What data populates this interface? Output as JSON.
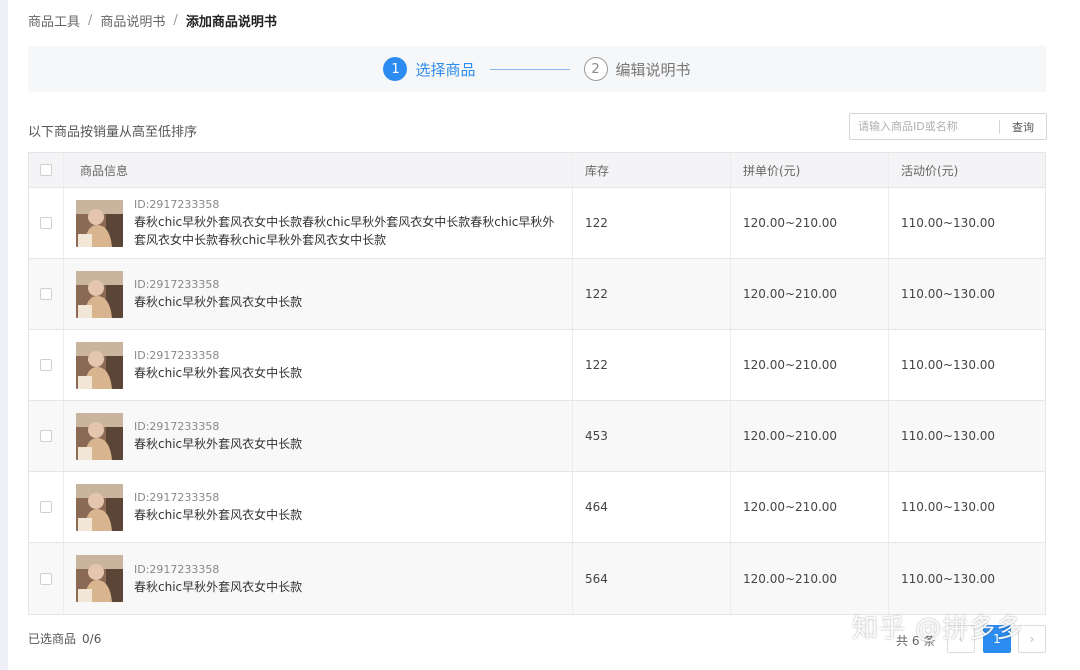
{
  "breadcrumb": {
    "items": [
      "商品工具",
      "商品说明书"
    ],
    "separator": "/",
    "current": "添加商品说明书"
  },
  "steps": [
    {
      "number": "1",
      "label": "选择商品",
      "state": "active"
    },
    {
      "number": "2",
      "label": "编辑说明书",
      "state": "inactive"
    }
  ],
  "toolbar": {
    "sort_note": "以下商品按销量从高至低排序",
    "search_placeholder": "请输入商品ID或名称",
    "search_button": "查询"
  },
  "table": {
    "headers": {
      "info": "商品信息",
      "stock": "库存",
      "group_price": "拼单价(元)",
      "activity_price": "活动价(元)"
    },
    "rows": [
      {
        "id": "ID:2917233358",
        "name": "春秋chic早秋外套风衣女中长款春秋chic早秋外套风衣女中长款春秋chic早秋外套风衣女中长款春秋chic早秋外套风衣女中长款",
        "stock": "122",
        "group_price": "120.00~210.00",
        "activity_price": "110.00~130.00"
      },
      {
        "id": "ID:2917233358",
        "name": "春秋chic早秋外套风衣女中长款",
        "stock": "122",
        "group_price": "120.00~210.00",
        "activity_price": "110.00~130.00"
      },
      {
        "id": "ID:2917233358",
        "name": "春秋chic早秋外套风衣女中长款",
        "stock": "122",
        "group_price": "120.00~210.00",
        "activity_price": "110.00~130.00"
      },
      {
        "id": "ID:2917233358",
        "name": "春秋chic早秋外套风衣女中长款",
        "stock": "453",
        "group_price": "120.00~210.00",
        "activity_price": "110.00~130.00"
      },
      {
        "id": "ID:2917233358",
        "name": "春秋chic早秋外套风衣女中长款",
        "stock": "464",
        "group_price": "120.00~210.00",
        "activity_price": "110.00~130.00"
      },
      {
        "id": "ID:2917233358",
        "name": "春秋chic早秋外套风衣女中长款",
        "stock": "564",
        "group_price": "120.00~210.00",
        "activity_price": "110.00~130.00"
      }
    ]
  },
  "footer": {
    "selected_label": "已选商品",
    "selected_count": "0/6",
    "total": "共 6 条",
    "pager": {
      "prev": "‹",
      "current": "1",
      "next": "›"
    }
  },
  "watermark": "知乎 @拼多多",
  "colors": {
    "accent": "#2d8cf0"
  }
}
